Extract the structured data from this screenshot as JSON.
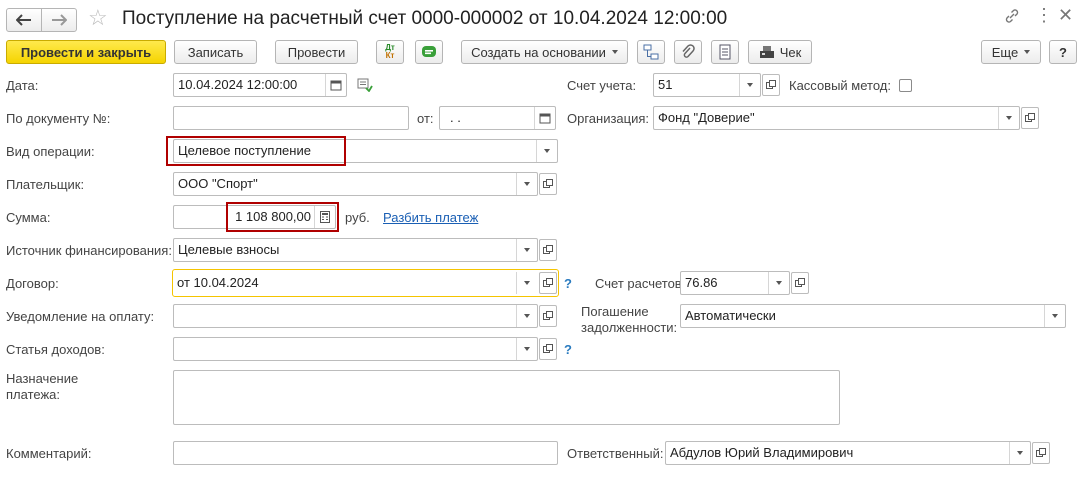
{
  "window": {
    "title": "Поступление на расчетный счет 0000-000002 от 10.04.2024 12:00:00"
  },
  "toolbar": {
    "post_close": "Провести и закрыть",
    "save": "Записать",
    "post": "Провести",
    "create_based": "Создать на основании",
    "receipt": "Чек",
    "more": "Еще",
    "help": "?",
    "dtkt_top": "Дт",
    "dtkt_bottom": "Кт"
  },
  "form": {
    "date_label": "Дата:",
    "date_value": "10.04.2024 12:00:00",
    "doc_num_label": "По документу №:",
    "doc_num_value": "",
    "from_label": "от:",
    "from_value": " .  .",
    "op_type_label": "Вид операции:",
    "op_type_value": "Целевое поступление",
    "payer_label": "Плательщик:",
    "payer_value": "ООО \"Спорт\"",
    "sum_label": "Сумма:",
    "sum_value": "1 108 800,00",
    "currency": "руб.",
    "split_link": "Разбить платеж",
    "source_label": "Источник финансирования:",
    "source_value": "Целевые взносы",
    "contract_label": "Договор:",
    "contract_value": "от 10.04.2024",
    "notice_label": "Уведомление на оплату:",
    "notice_value": "",
    "income_label": "Статья доходов:",
    "income_value": "",
    "purpose_label": "Назначение платежа:",
    "purpose_value": "",
    "comment_label": "Комментарий:",
    "comment_value": "",
    "account_label": "Счет учета:",
    "account_value": "51",
    "cash_method_label": "Кассовый метод:",
    "cash_method_checked": false,
    "org_label": "Организация:",
    "org_value": "Фонд \"Доверие\"",
    "settle_label": "Счет расчетов:",
    "settle_value": "76.86",
    "repay_label_1": "Погашение",
    "repay_label_2": "задолженности:",
    "repay_value": "Автоматически",
    "responsible_label": "Ответственный:",
    "responsible_value": "Абдулов Юрий Владимирович",
    "help_mark": "?"
  },
  "colors": {
    "primary_button": "#f5d400",
    "highlight_box": "#b00000",
    "focus_border": "#f5c400",
    "link": "#1a5fb4"
  }
}
